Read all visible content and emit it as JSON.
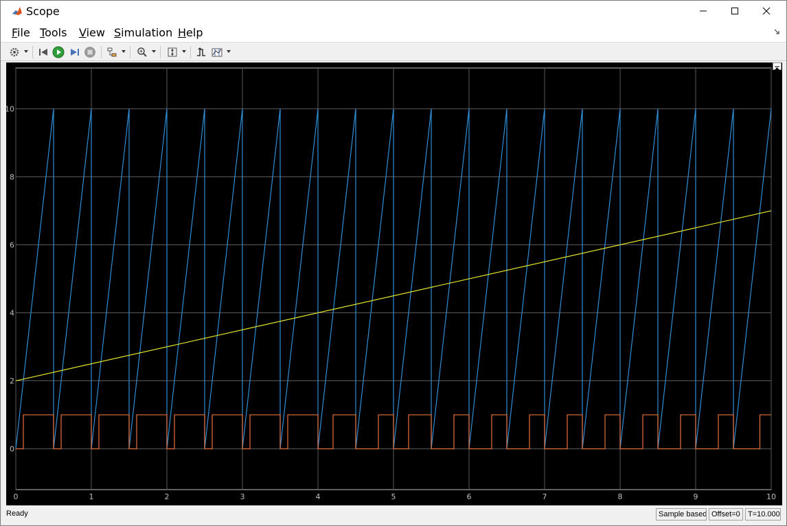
{
  "window": {
    "title": "Scope"
  },
  "menu": {
    "file": {
      "mnemonic": "F",
      "rest": "ile"
    },
    "tools": {
      "mnemonic": "T",
      "rest": "ools"
    },
    "view": {
      "mnemonic": "V",
      "rest": "iew"
    },
    "simulation": {
      "mnemonic": "S",
      "rest": "imulation"
    },
    "help": {
      "mnemonic": "H",
      "rest": "elp"
    }
  },
  "toolbar": {
    "icons": [
      "settings-icon",
      "step-back-icon",
      "run-icon",
      "step-forward-icon",
      "stop-icon",
      "highlight-block-icon",
      "zoom-icon",
      "scale-axes-icon",
      "triggers-icon",
      "cursor-measurements-icon"
    ]
  },
  "status": {
    "ready": "Ready",
    "sample_based": "Sample based",
    "offset": "Offset=0",
    "time": "T=10.000"
  },
  "colors": {
    "plot_background": "#000000",
    "grid": "#5a5a5a",
    "tick_text": "#bfbfbf",
    "series_sawtooth": "#2f8fd8",
    "series_ramp": "#e6e62a",
    "series_pulse": "#e8703a"
  },
  "chart_data": {
    "type": "line",
    "xlim": [
      0,
      10
    ],
    "ylim": [
      -1.2,
      11.2
    ],
    "xticks": [
      "0",
      "1",
      "2",
      "3",
      "4",
      "5",
      "6",
      "7",
      "8",
      "9",
      "10"
    ],
    "yticks": [
      "0",
      "2",
      "4",
      "6",
      "8",
      "10"
    ],
    "grid": true,
    "series": [
      {
        "color": "#2f8fd8",
        "x": [
          0,
          0.5,
          0.5,
          1.0,
          1.0,
          1.5,
          1.5,
          2.0,
          2.0,
          2.5,
          2.5,
          3.0,
          3.0,
          3.5,
          3.5,
          4.0,
          4.0,
          4.5,
          4.5,
          5.0,
          5.0,
          5.5,
          5.5,
          6.0,
          6.0,
          6.5,
          6.5,
          7.0,
          7.0,
          7.5,
          7.5,
          8.0,
          8.0,
          8.5,
          8.5,
          9.0,
          9.0,
          9.5,
          9.5,
          10.0
        ],
        "y": [
          0,
          10,
          0,
          10,
          0,
          10,
          0,
          10,
          0,
          10,
          0,
          10,
          0,
          10,
          0,
          10,
          0,
          10,
          0,
          10,
          0,
          10,
          0,
          10,
          0,
          10,
          0,
          10,
          0,
          10,
          0,
          10,
          0,
          10,
          0,
          10,
          0,
          10,
          0,
          10
        ]
      },
      {
        "color": "#e6e62a",
        "x": [
          0,
          10
        ],
        "y": [
          2,
          7
        ]
      },
      {
        "color": "#e8703a",
        "x": [
          0,
          0.1,
          0.1,
          0.5,
          0.5,
          0.6,
          0.6,
          1.0,
          1.0,
          1.1,
          1.1,
          1.5,
          1.5,
          1.6,
          1.6,
          2.0,
          2.0,
          2.1,
          2.1,
          2.5,
          2.5,
          2.6,
          2.6,
          3.0,
          3.0,
          3.1,
          3.1,
          3.5,
          3.5,
          3.6,
          3.6,
          4.0,
          4.0,
          4.2,
          4.2,
          4.5,
          4.5,
          4.8,
          4.8,
          5.0,
          5.0,
          5.2,
          5.2,
          5.5,
          5.5,
          5.8,
          5.8,
          6.0,
          6.0,
          6.3,
          6.3,
          6.5,
          6.5,
          6.8,
          6.8,
          7.0,
          7.0,
          7.3,
          7.3,
          7.5,
          7.5,
          7.8,
          7.8,
          8.0,
          8.0,
          8.3,
          8.3,
          8.5,
          8.5,
          8.8,
          8.8,
          9.0,
          9.0,
          9.3,
          9.3,
          9.5,
          9.5,
          9.85,
          9.85,
          10.0
        ],
        "y": [
          0,
          0,
          1,
          1,
          0,
          0,
          1,
          1,
          0,
          0,
          1,
          1,
          0,
          0,
          1,
          1,
          0,
          0,
          1,
          1,
          0,
          0,
          1,
          1,
          0,
          0,
          1,
          1,
          0,
          0,
          1,
          1,
          0,
          0,
          1,
          1,
          0,
          0,
          1,
          1,
          0,
          0,
          1,
          1,
          0,
          0,
          1,
          1,
          0,
          0,
          1,
          1,
          0,
          0,
          1,
          1,
          0,
          0,
          1,
          1,
          0,
          0,
          1,
          1,
          0,
          0,
          1,
          1,
          0,
          0,
          1,
          1,
          0,
          0,
          1,
          1,
          0,
          0,
          1,
          1
        ]
      }
    ]
  }
}
